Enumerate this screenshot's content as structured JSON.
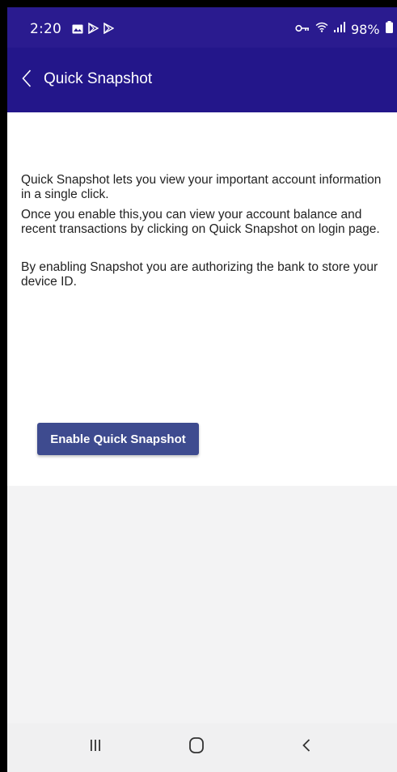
{
  "status_bar": {
    "time": "2:20",
    "battery_text": "98%",
    "icons": [
      "gallery-icon",
      "play-store-icon",
      "play-store-icon",
      "vpn-key-icon",
      "wifi-icon",
      "signal-icon",
      "battery-icon"
    ]
  },
  "app_bar": {
    "title": "Quick Snapshot",
    "back_icon": "chevron-left-icon"
  },
  "content": {
    "paragraph_1": "Quick Snapshot lets you view your important account information in a single click.",
    "paragraph_2": "Once you enable this,you can view your account balance and recent transactions by clicking on Quick Snapshot on login page.",
    "paragraph_3": "By enabling Snapshot you are authorizing the bank to store your device ID.",
    "enable_button_label": "Enable Quick Snapshot"
  },
  "nav_bar": {
    "icons": [
      "recents-icon",
      "home-icon",
      "back-icon"
    ]
  },
  "colors": {
    "status_bar": "#2a1b8f",
    "app_bar": "#23168a",
    "button": "#3e4b8f",
    "background": "#f3f3f4"
  }
}
